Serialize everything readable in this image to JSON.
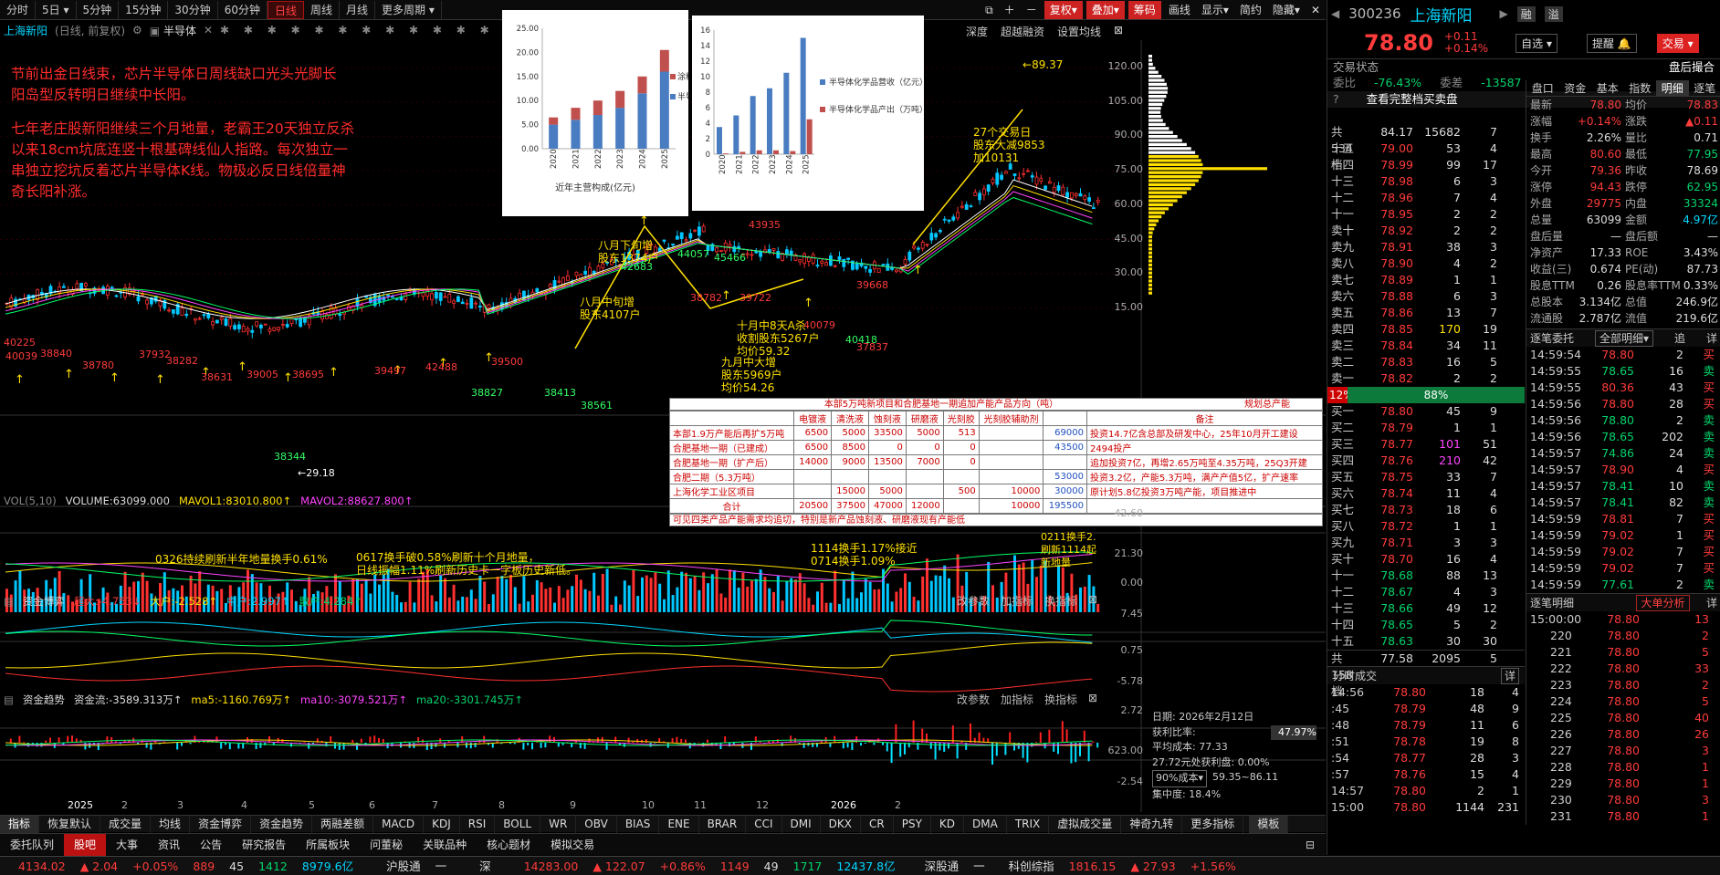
{
  "toolbar": {
    "periods": [
      "分时",
      "5日",
      "5分钟",
      "15分钟",
      "30分钟",
      "60分钟",
      "日线",
      "周线",
      "月线",
      "更多周期"
    ],
    "active": "日线",
    "right": [
      "复权",
      "叠加",
      "筹码",
      "画线",
      "显示",
      "简约",
      "隐藏"
    ]
  },
  "subbar": {
    "stock": "上海新阳",
    "adj": "(日线, 前复权)",
    "sector": "半导体",
    "items": [
      "深度",
      "超越融资",
      "设置均线"
    ]
  },
  "notes": {
    "p1": "节前出金日线束，芯片半导体日周线缺口光头光脚长阳岛型反转明日继续中长阳。",
    "p2": "七年老庄股新阳继续三个月地量，老霸王20天独立反杀以来18cm坑底连竖十根基碑线仙人指路。每次独立一串独立挖坑反着芯片半导体K线。物极必反日线倍量神奇长阳补涨。"
  },
  "price_axis": [
    "120.00",
    "105.00",
    "90.00",
    "75.00",
    "60.00",
    "45.00",
    "30.00",
    "15.00"
  ],
  "chart_annotations": {
    "high": "89.37",
    "low": "29.18",
    "a1": "八月下旬增\n股东1374户",
    "a2": "八月中旬增\n股东4107户",
    "a3": "十月中8天A杀\n收割股东5267户\n均价59.32",
    "a4": "九月中大增\n股东5969户\n均价54.26",
    "a5": "27个交易日\n股东大减9853\n加10131"
  },
  "price_labels_red": [
    "40225",
    "40039",
    "38840",
    "38780",
    "37932",
    "38282",
    "38631",
    "39005",
    "38695",
    "39497",
    "42488",
    "39500",
    "38782",
    "39722",
    "40079",
    "39668",
    "37837",
    "43935"
  ],
  "price_labels_green": [
    "38561",
    "38827",
    "38413",
    "38344",
    "42683",
    "44057",
    "45466",
    "40418"
  ],
  "chart1": {
    "title": "近年主营构成(亿元)",
    "categories": [
      "2020",
      "2021",
      "2022",
      "2023",
      "2024",
      "2025"
    ],
    "series": [
      {
        "name": "涂料",
        "values": [
          1.5,
          2.5,
          3.0,
          3.5,
          3.5,
          4.5
        ]
      },
      {
        "name": "半导体",
        "values": [
          5.0,
          6.0,
          7.0,
          8.5,
          11.5,
          16.0
        ]
      }
    ],
    "ylim": [
      0,
      25
    ],
    "yticks": [
      "25.00",
      "20.00",
      "15.00",
      "10.00",
      "5.00",
      "0.00"
    ],
    "type": "bar"
  },
  "chart2": {
    "categories": [
      "2020",
      "2021",
      "2022",
      "2023",
      "2024",
      "2025"
    ],
    "series": [
      {
        "name": "半导体化学品营收（亿元）",
        "values": [
          3.5,
          5.0,
          7.5,
          8.5,
          10.5,
          15.0
        ]
      },
      {
        "name": "半导体化学品产出（万吨）",
        "values": [
          0.1,
          0.3,
          0.5,
          0.5,
          0.4,
          4.5
        ]
      }
    ],
    "ylim": [
      0,
      16
    ],
    "yticks": [
      "16",
      "14",
      "12",
      "10",
      "8",
      "6",
      "4",
      "2",
      "0"
    ],
    "type": "bar"
  },
  "table": {
    "title": "本部5万吨新项目和合肥基地一期追加产能产品方向（吨）",
    "title2": "规划总产能",
    "headers": [
      "",
      "电镀液",
      "清洗液",
      "蚀刻液",
      "研磨液",
      "光刻胶",
      "光刻胶辅助剂",
      "",
      "备注"
    ],
    "rows": [
      [
        "本部1.9万产能后再扩5万吨",
        "6500",
        "5000",
        "33500",
        "5000",
        "513",
        "",
        "69000",
        "投资14.7亿含总部及研发中心，25年10月开工建设"
      ],
      [
        "合肥基地一期（已建成）",
        "6500",
        "8500",
        "0",
        "0",
        "0",
        "",
        "43500",
        "2494投产"
      ],
      [
        "合肥基地一期（扩产后）",
        "14000",
        "9000",
        "13500",
        "7000",
        "0",
        "",
        "",
        "追加投资7亿，再增2.65万吨至4.35万吨，25Q3开建"
      ],
      [
        "合肥二期（5.3万吨）",
        "",
        "",
        "",
        "",
        "",
        "",
        "53000",
        "投资3.2亿，产能5.3万吨，满产产值5亿，扩产速率"
      ],
      [
        "上海化学工业区项目",
        "",
        "15000",
        "5000",
        "",
        "500",
        "10000",
        "30000",
        "原计划5.8亿投资3万吨产能，项目推进中"
      ],
      [
        "合计",
        "20500",
        "37500",
        "47000",
        "12000",
        "",
        "10000",
        "195500",
        ""
      ]
    ],
    "footer": "可见四类产品产能需求均追切，特别是新产品蚀刻液、研磨液现有产能低"
  },
  "vol_panel": {
    "label": "VOL(5,10)",
    "v1": "VOLUME:63099.000",
    "v2": "MAVOL1:83010.800",
    "v3": "MAVOL2:88627.800",
    "axis": [
      "42.60",
      "21.30",
      "0.00"
    ],
    "ann": [
      "0326持续刷新半年地量换手0.61%",
      "0617换手破0.58%刷新十个月地量，\n日线振幅1.11%刷新历史卡一字板历史新低。",
      "1114换手1.17%接近\n0714换手1.09%",
      "0211换手2.\n刷新1114起\n新地量"
    ]
  },
  "fund_panel": {
    "label": "资金博弈",
    "v1": "超大:-4.753",
    "v2": "大户:-2.528",
    "v3": "中户:2.997",
    "v4": "散户:4.284",
    "btns": [
      "改参数",
      "加指标",
      "换指标"
    ],
    "axis": [
      "7.45",
      "0.75",
      "-5.78"
    ]
  },
  "flow_panel": {
    "label": "资金趋势",
    "v1": "资金流:-3589.313万",
    "v2": "ma5:-1160.769万",
    "v3": "ma10:-3079.521万",
    "v4": "ma20:-3301.745万",
    "btns": [
      "改参数",
      "加指标",
      "换指标"
    ],
    "axis": [
      "2.72",
      "623.00",
      "-2.54"
    ]
  },
  "cost": {
    "date": "日期: 2026年2月12日",
    "profit_label": "获利比率:",
    "profit": "47.97%",
    "avg": "平均成本: 77.33",
    "tip": "27.72元处获利盘: 0.00%",
    "sel": "90%成本",
    "range": "59.35~86.11",
    "conc": "集中度: 18.4%"
  },
  "months": [
    "2025",
    "2",
    "3",
    "4",
    "5",
    "6",
    "7",
    "8",
    "9",
    "10",
    "11",
    "12",
    "2026",
    "2"
  ],
  "tabs1": [
    "指标",
    "恢复默认",
    "成交量",
    "均线",
    "资金博弈",
    "资金趋势",
    "两融差额",
    "MACD",
    "KDJ",
    "RSI",
    "BOLL",
    "WR",
    "OBV",
    "BIAS",
    "ENE",
    "BRAR",
    "CCI",
    "DMI",
    "DKX",
    "CR",
    "PSY",
    "KD",
    "DMA",
    "TRIX",
    "虚拟成交量",
    "神奇九转",
    "更多指标",
    "模板"
  ],
  "tabs2": [
    "委托队列",
    "股吧",
    "大事",
    "资讯",
    "公告",
    "研究报告",
    "所属板块",
    "问董秘",
    "关联品种",
    "核心题材",
    "模拟交易"
  ],
  "status": {
    "sh": "4134.02",
    "sh_chg": "▲ 2.04",
    "sh_pct": "+0.05%",
    "sh_up": "889",
    "sh_eq": "45",
    "sh_dn": "1412",
    "sh_amt": "8979.6亿",
    "hgt": "沪股通",
    "hgt_v": "一",
    "sz_lbl": "深",
    "sz": "14283.00",
    "sz_chg": "▲ 122.07",
    "sz_pct": "+0.86%",
    "sz_up": "1149",
    "sz_eq": "49",
    "sz_dn": "1717",
    "sz_amt": "12437.8亿",
    "sgt": "深股通",
    "sgt_v": "一",
    "kc": "科创综指",
    "kc_v": "1816.15",
    "kc_chg": "▲ 27.93",
    "kc_pct": "+1.56%"
  },
  "quote": {
    "code": "300236",
    "name": "上海新阳",
    "price": "78.80",
    "chg": "+0.11",
    "pct": "+0.14%",
    "btns": [
      "融",
      "溢"
    ],
    "self": "自选",
    "remind": "提醒",
    "trade": "交易"
  },
  "status_row": {
    "label": "交易状态",
    "value": "盘后撮合"
  },
  "weibi": {
    "l1": "委比",
    "v1": "-76.43%",
    "l2": "委差",
    "v2": "-13587"
  },
  "full_book": "查看完整档买卖盘",
  "sells_total": {
    "label": "共534档",
    "price": "84.17",
    "vol": "15682",
    "n": "7"
  },
  "sells": [
    [
      "十五",
      "79.00",
      "53",
      "4"
    ],
    [
      "十四",
      "78.99",
      "99",
      "17"
    ],
    [
      "十三",
      "78.98",
      "6",
      "3"
    ],
    [
      "十二",
      "78.96",
      "7",
      "4"
    ],
    [
      "十一",
      "78.95",
      "2",
      "2"
    ],
    [
      "卖十",
      "78.92",
      "2",
      "2"
    ],
    [
      "卖九",
      "78.91",
      "38",
      "3"
    ],
    [
      "卖八",
      "78.90",
      "4",
      "2"
    ],
    [
      "卖七",
      "78.89",
      "1",
      "1"
    ],
    [
      "卖六",
      "78.88",
      "6",
      "3"
    ],
    [
      "卖五",
      "78.86",
      "13",
      "7"
    ],
    [
      "卖四",
      "78.85",
      "170",
      "19"
    ],
    [
      "卖三",
      "78.84",
      "34",
      "11"
    ],
    [
      "卖二",
      "78.83",
      "16",
      "5"
    ],
    [
      "卖一",
      "78.82",
      "2",
      "2"
    ]
  ],
  "ratio": {
    "l": "12%",
    "r": "88%"
  },
  "buys": [
    [
      "买一",
      "78.80",
      "45",
      "9"
    ],
    [
      "买二",
      "78.79",
      "1",
      "1"
    ],
    [
      "买三",
      "78.77",
      "101",
      "51"
    ],
    [
      "买四",
      "78.76",
      "210",
      "42"
    ],
    [
      "买五",
      "78.75",
      "33",
      "7"
    ],
    [
      "买六",
      "78.74",
      "11",
      "4"
    ],
    [
      "买七",
      "78.73",
      "18",
      "6"
    ],
    [
      "买八",
      "78.72",
      "1",
      "1"
    ],
    [
      "买九",
      "78.71",
      "3",
      "3"
    ],
    [
      "买十",
      "78.70",
      "16",
      "4"
    ],
    [
      "十一",
      "78.68",
      "88",
      "13"
    ],
    [
      "十二",
      "78.67",
      "4",
      "3"
    ],
    [
      "十三",
      "78.66",
      "49",
      "12"
    ],
    [
      "十四",
      "78.65",
      "5",
      "2"
    ],
    [
      "十五",
      "78.63",
      "30",
      "30"
    ]
  ],
  "buys_total": {
    "label": "共158档",
    "price": "77.58",
    "vol": "2095",
    "n": "5"
  },
  "stats": [
    [
      "最新",
      "78.80",
      "均价",
      "78.83"
    ],
    [
      "涨幅",
      "+0.14%",
      "涨跌",
      "▲0.11"
    ],
    [
      "换手",
      "2.26%",
      "量比",
      "0.71"
    ],
    [
      "最高",
      "80.60",
      "最低",
      "77.95"
    ],
    [
      "今开",
      "79.36",
      "昨收",
      "78.69"
    ],
    [
      "涨停",
      "94.43",
      "跌停",
      "62.95"
    ],
    [
      "外盘",
      "29775",
      "内盘",
      "33324"
    ],
    [
      "总量",
      "63099",
      "金额",
      "4.97亿"
    ],
    [
      "盘后量",
      "—",
      "盘后额",
      "—"
    ],
    [
      "净资产",
      "17.33",
      "ROE",
      "3.43%"
    ],
    [
      "收益(三)",
      "0.674",
      "PE(动)",
      "87.73"
    ],
    [
      "股息TTM",
      "0.26",
      "股息率TTM",
      "0.33%"
    ],
    [
      "总股本",
      "3.134亿",
      "总值",
      "246.9亿"
    ],
    [
      "流通股",
      "2.787亿",
      "流值",
      "219.6亿"
    ]
  ],
  "stat_tabs": [
    "盘口",
    "资金",
    "基本",
    "指数",
    "明细",
    "逐笔"
  ],
  "orders_hdr": {
    "title": "逐笔委托",
    "sel": "全部明细",
    "btn": "追"
  },
  "orders": [
    [
      "14:59:54",
      "78.80",
      "2",
      "买"
    ],
    [
      "14:59:55",
      "78.65",
      "16",
      "卖"
    ],
    [
      "14:59:55",
      "80.36",
      "43",
      "买"
    ],
    [
      "14:59:56",
      "78.80",
      "28",
      "买"
    ],
    [
      "14:59:56",
      "78.80",
      "2",
      "卖"
    ],
    [
      "14:59:56",
      "78.65",
      "202",
      "卖"
    ],
    [
      "14:59:57",
      "74.86",
      "24",
      "卖"
    ],
    [
      "14:59:57",
      "78.90",
      "4",
      "买"
    ],
    [
      "14:59:57",
      "78.41",
      "10",
      "卖"
    ],
    [
      "14:59:57",
      "78.41",
      "82",
      "卖"
    ],
    [
      "14:59:59",
      "78.81",
      "7",
      "买"
    ],
    [
      "14:59:59",
      "79.02",
      "1",
      "买"
    ],
    [
      "14:59:59",
      "79.02",
      "7",
      "买"
    ],
    [
      "14:59:59",
      "79.02",
      "7",
      "买"
    ],
    [
      "14:59:59",
      "77.61",
      "2",
      "卖"
    ]
  ],
  "detail_hdr": {
    "title": "逐笔明细",
    "btn": "大单分析",
    "btn2": "详"
  },
  "details": [
    [
      "15:00:00",
      "78.80",
      "13"
    ],
    [
      "220",
      "78.80",
      "2"
    ],
    [
      "221",
      "78.80",
      "5"
    ],
    [
      "222",
      "78.80",
      "33"
    ],
    [
      "223",
      "78.80",
      "2"
    ],
    [
      "224",
      "78.80",
      "5"
    ],
    [
      "225",
      "78.80",
      "40"
    ],
    [
      "226",
      "78.80",
      "26"
    ],
    [
      "227",
      "78.80",
      "3"
    ],
    [
      "228",
      "78.80",
      "1"
    ],
    [
      "229",
      "78.80",
      "1"
    ],
    [
      "230",
      "78.80",
      "3"
    ],
    [
      "231",
      "78.80",
      "1"
    ]
  ],
  "ticks_hdr": {
    "title": "分时成交",
    "btn": "详"
  },
  "ticks": [
    [
      "14:56",
      "78.80",
      "18",
      "4"
    ],
    [
      ":45",
      "78.79",
      "48",
      "9"
    ],
    [
      ":48",
      "78.79",
      "11",
      "6"
    ],
    [
      ":51",
      "78.78",
      "19",
      "8"
    ],
    [
      ":54",
      "78.77",
      "28",
      "3"
    ],
    [
      ":57",
      "78.76",
      "15",
      "4"
    ],
    [
      "14:57",
      "78.80",
      "2",
      "1"
    ],
    [
      "15:00",
      "78.80",
      "1144",
      "231"
    ]
  ],
  "colors": {
    "up": "#ff3b3b",
    "down": "#00d36b",
    "accent": "#ffe000"
  }
}
